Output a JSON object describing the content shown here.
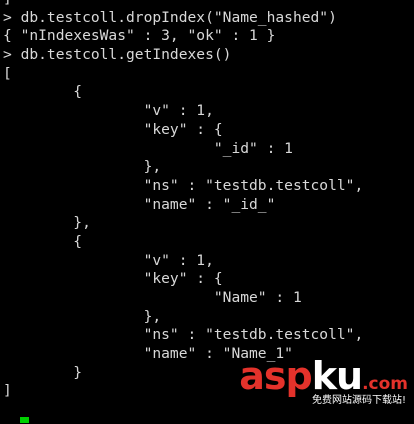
{
  "terminal": {
    "lines": [
      "]",
      "> db.testcoll.dropIndex(\"Name_hashed\")",
      "{ \"nIndexesWas\" : 3, \"ok\" : 1 }",
      "> db.testcoll.getIndexes()",
      "[",
      "        {",
      "                \"v\" : 1,",
      "                \"key\" : {",
      "                        \"_id\" : 1",
      "                },",
      "                \"ns\" : \"testdb.testcoll\",",
      "                \"name\" : \"_id_\"",
      "        },",
      "        {",
      "                \"v\" : 1,",
      "                \"key\" : {",
      "                        \"Name\" : 1",
      "                },",
      "                \"ns\" : \"testdb.testcoll\",",
      "                \"name\" : \"Name_1\"",
      "        }",
      "]"
    ],
    "cursor_color": "#00d000",
    "text_color": "#d8d8d8",
    "background": "#000000"
  },
  "watermark": {
    "logo_part1": "asp",
    "logo_part2": "ku",
    "logo_part3": ".com",
    "subtitle": "免费网站源码下载站!",
    "brand_color": "#e4322b"
  }
}
